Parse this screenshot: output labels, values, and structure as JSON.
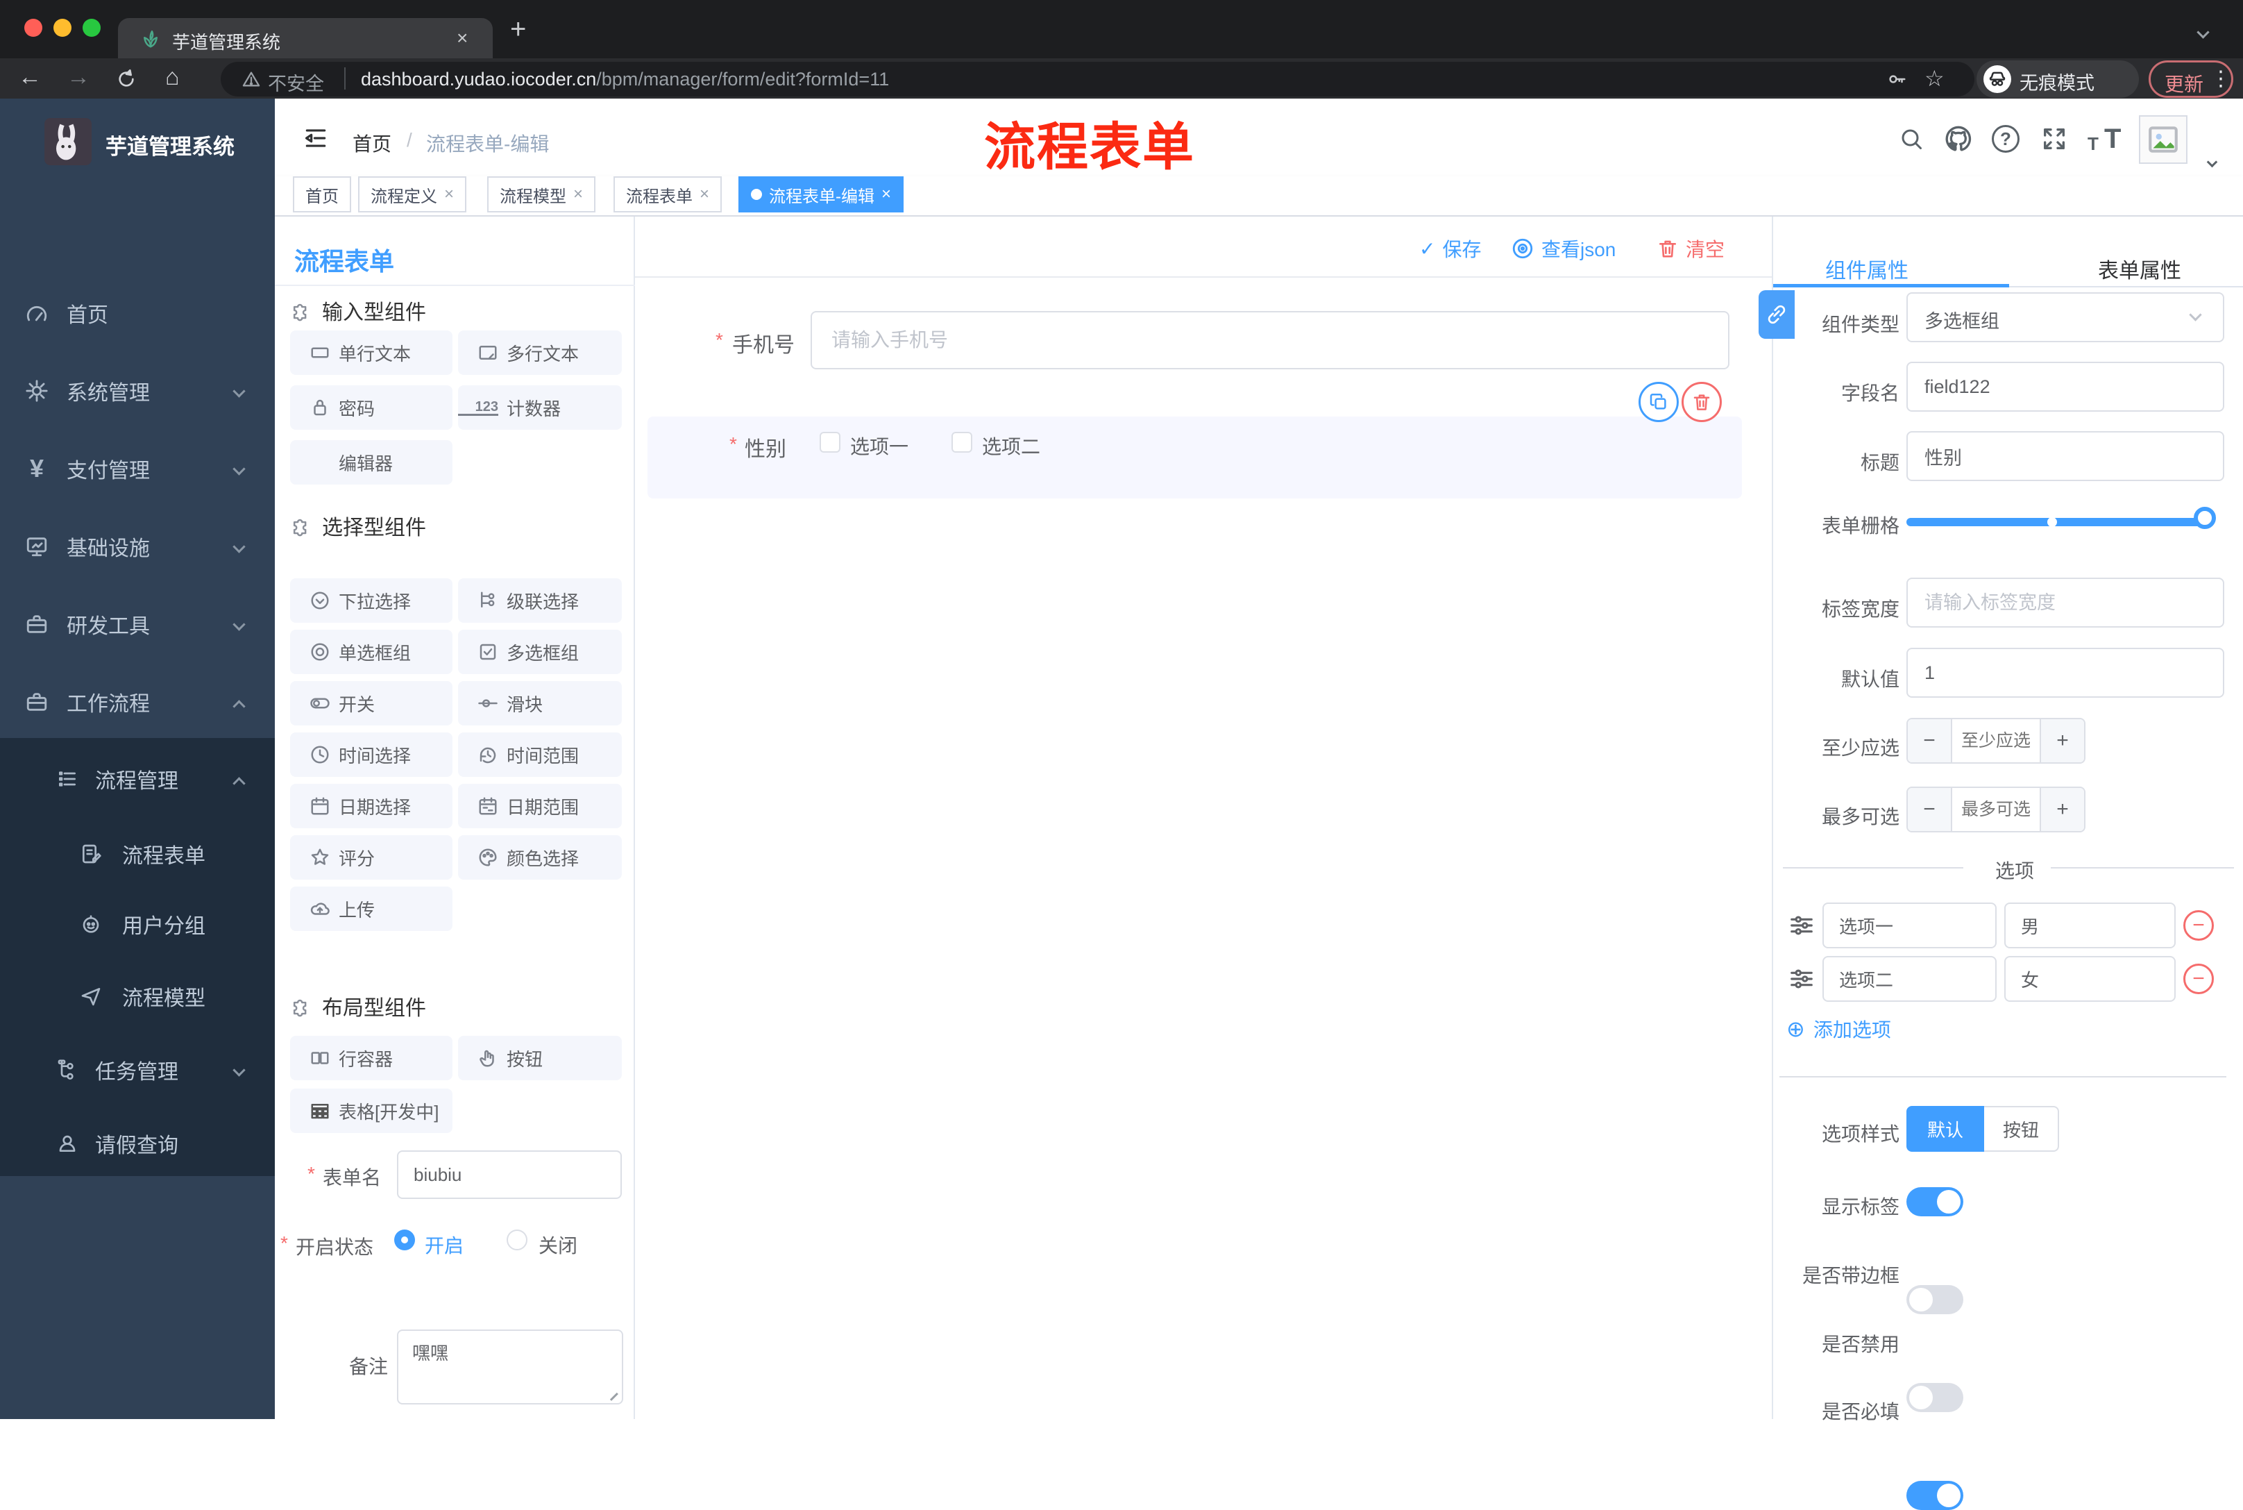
{
  "colors": {
    "accent": "#409EFF",
    "danger": "#F56C6C",
    "annotation_red": "#FB2A12",
    "sidebar_bg": "#304156",
    "submenu_bg": "#1F2D3D",
    "active_tag": "#409EFF"
  },
  "icons": {
    "back": "←",
    "forward": "→",
    "home": "⌂",
    "star": "☆",
    "dots": "⋮",
    "close": "×",
    "plus": "+",
    "check": "✓",
    "question": "?",
    "counter": "123",
    "tt_small": "T",
    "tt_big": "T",
    "plus_circled": "⊕",
    "minus": "−",
    "asterisk": "*",
    "slash": "/",
    "warning": "⚠"
  },
  "browser": {
    "tab_title": "芋道管理系统",
    "not_secure": "不安全",
    "url_domain": "dashboard.yudao.iocoder.cn",
    "url_path": "/bpm/manager/form/edit?formId=11",
    "incognito_label": "无痕模式",
    "update_label": "更新"
  },
  "header": {
    "breadcrumb_home": "首页",
    "breadcrumb_current": "流程表单-编辑",
    "annotation": "流程表单"
  },
  "tags": {
    "t0": "首页",
    "t1": "流程定义",
    "t2": "流程模型",
    "t3": "流程表单",
    "t4": "流程表单-编辑"
  },
  "sidebar": {
    "title": "芋道管理系统",
    "home": "首页",
    "system": "系统管理",
    "pay": "支付管理",
    "infra": "基础设施",
    "dev": "研发工具",
    "workflow": "工作流程",
    "process_mgmt": "流程管理",
    "process_form": "流程表单",
    "user_group": "用户分组",
    "process_model": "流程模型",
    "task_mgmt": "任务管理",
    "leave_query": "请假查询"
  },
  "palette": {
    "title": "流程表单",
    "sec_input": "输入型组件",
    "sec_select": "选择型组件",
    "sec_layout": "布局型组件",
    "items": {
      "single": "单行文本",
      "multi": "多行文本",
      "password": "密码",
      "counter": "计数器",
      "editor": "编辑器",
      "select": "下拉选择",
      "cascade": "级联选择",
      "radio_group": "单选框组",
      "checkbox_group": "多选框组",
      "switch": "开关",
      "slider": "滑块",
      "time": "时间选择",
      "time_range": "时间范围",
      "date": "日期选择",
      "date_range": "日期范围",
      "rate": "评分",
      "color": "颜色选择",
      "upload": "上传",
      "row": "行容器",
      "button": "按钮",
      "table": "表格[开发中]"
    },
    "form": {
      "name_label": "表单名",
      "name_value": "biubiu",
      "status_label": "开启状态",
      "status_on": "开启",
      "status_off": "关闭",
      "remark_label": "备注",
      "remark_value": "嘿嘿"
    }
  },
  "canvas": {
    "save": "保存",
    "view_json": "查看json",
    "clear": "清空",
    "phone_label": "手机号",
    "phone_placeholder": "请输入手机号",
    "gender_label": "性别",
    "gender_opt1": "选项一",
    "gender_opt2": "选项二"
  },
  "props": {
    "tab_component": "组件属性",
    "tab_form": "表单属性",
    "type_label": "组件类型",
    "type_value": "多选框组",
    "field_label": "字段名",
    "field_value": "field122",
    "title_label": "标题",
    "title_value": "性别",
    "grid_label": "表单栅格",
    "width_label": "标签宽度",
    "width_placeholder": "请输入标签宽度",
    "default_label": "默认值",
    "default_value": "1",
    "min_label": "至少应选",
    "min_placeholder": "至少应选",
    "max_label": "最多可选",
    "max_placeholder": "最多可选",
    "options_title": "选项",
    "opt1_label": "选项一",
    "opt1_value": "男",
    "opt2_label": "选项二",
    "opt2_value": "女",
    "add_option": "添加选项",
    "style_label": "选项样式",
    "style_default": "默认",
    "style_button": "按钮",
    "show_label": "显示标签",
    "border_label": "是否带边框",
    "disabled_label": "是否禁用",
    "required_label": "是否必填"
  }
}
